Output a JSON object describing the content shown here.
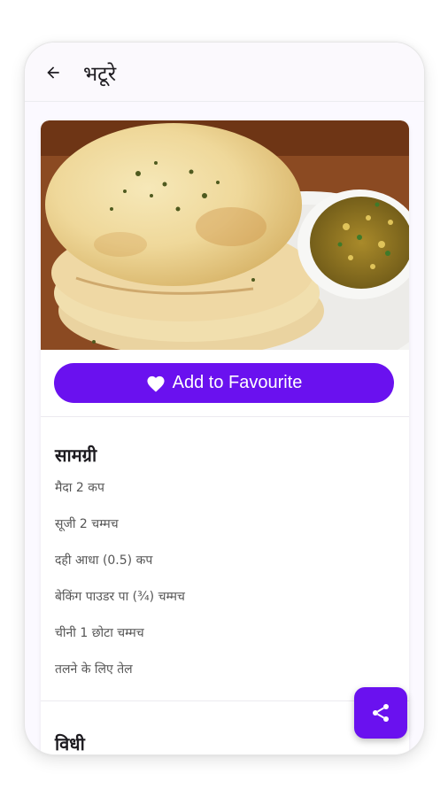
{
  "appbar": {
    "title": "भटूरे",
    "back_icon": "arrow-left-icon"
  },
  "favourite_button": {
    "label": "Add to Favourite",
    "icon": "heart-icon"
  },
  "ingredients": {
    "heading": "सामग्री",
    "items": [
      "मैदा 2 कप",
      "सूजी 2 चम्मच",
      "दही आधा (0.5) कप",
      "बेकिंग पाउडर पा (¾) चम्मच",
      "चीनी 1 छोटा चम्मच",
      "तलने के लिए तेल"
    ]
  },
  "method": {
    "heading": "विधी"
  },
  "share_button": {
    "icon": "share-icon"
  },
  "colors": {
    "accent": "#6a11ef",
    "background": "#fbf9ff"
  }
}
